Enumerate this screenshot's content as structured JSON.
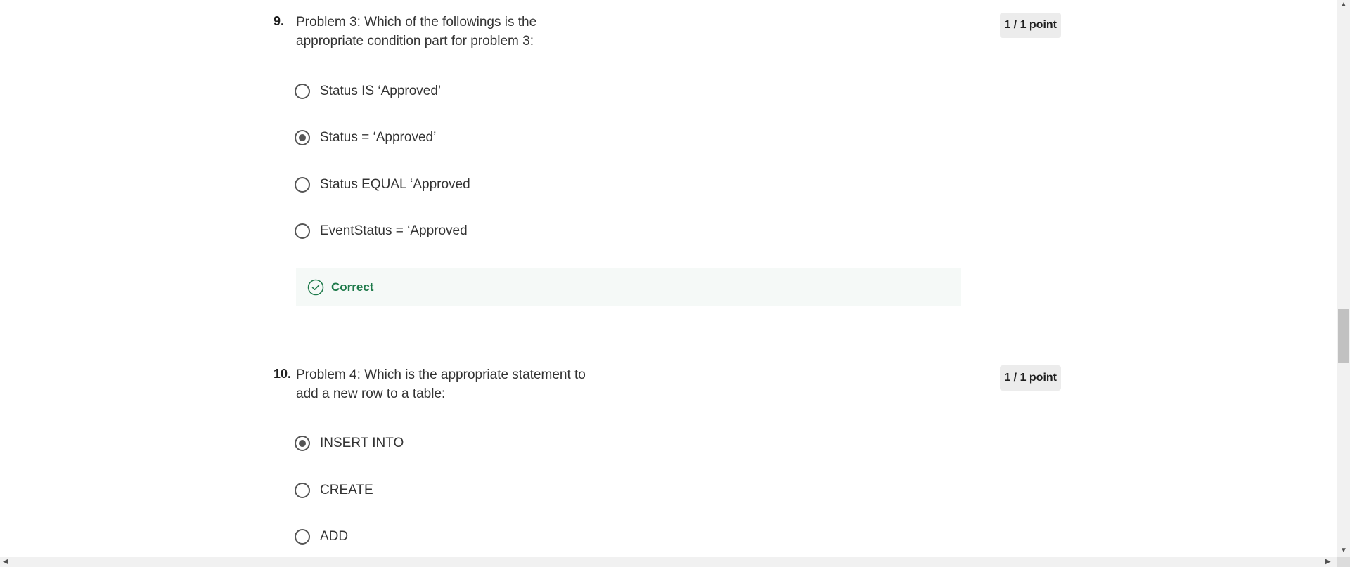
{
  "questions": [
    {
      "number": "9.",
      "text": "Problem 3: Which of the followings is the appropriate condition part for problem 3:",
      "points": "1 / 1 point",
      "options": [
        {
          "label": "Status IS ‘Approved’",
          "selected": false
        },
        {
          "label": "Status = ‘Approved’",
          "selected": true
        },
        {
          "label": "Status EQUAL ‘Approved",
          "selected": false
        },
        {
          "label": "EventStatus = ‘Approved",
          "selected": false
        }
      ],
      "feedback": "Correct"
    },
    {
      "number": "10.",
      "text": "Problem 4: Which is the appropriate statement to add a new row to a table:",
      "points": "1 / 1 point",
      "options": [
        {
          "label": "INSERT INTO",
          "selected": true
        },
        {
          "label": "CREATE",
          "selected": false
        },
        {
          "label": "ADD",
          "selected": false
        }
      ]
    }
  ],
  "icons": {
    "feedback": "check-circle-icon",
    "scroll_up": "triangle-up-icon",
    "scroll_down": "triangle-down-icon",
    "scroll_left": "triangle-left-icon",
    "scroll_right": "triangle-right-icon"
  },
  "colors": {
    "correct": "#1e7a4a",
    "feedback_bg": "#f5f9f7",
    "points_bg": "#ececec"
  }
}
